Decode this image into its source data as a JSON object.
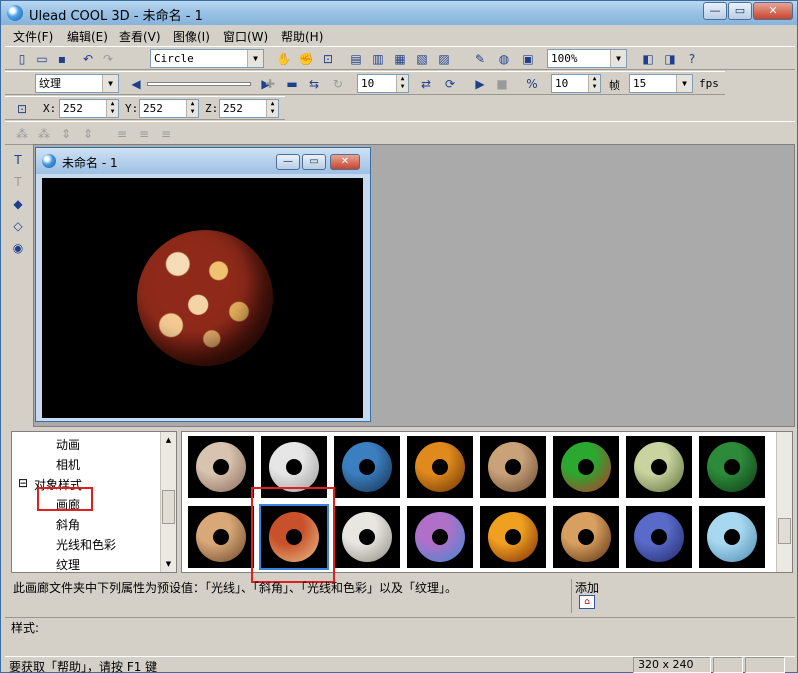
{
  "window": {
    "title": "Ulead COOL 3D - 未命名 - 1",
    "min": "—",
    "restore": "▭",
    "close": "✕"
  },
  "menu": [
    "文件(F)",
    "编辑(E)",
    "查看(V)",
    "图像(I)",
    "窗口(W)",
    "帮助(H)"
  ],
  "toolbar1": {
    "object_combo": "Circle",
    "zoom_combo": "100%"
  },
  "toolbar2": {
    "attribute_combo": "纹理",
    "frame_value_a": "10",
    "frame_value_b": "10",
    "frame_label": "帧",
    "fps_value": "15",
    "fps_label": "fps"
  },
  "toolbar3": {
    "x_label": "X:",
    "x_value": "252",
    "y_label": "Y:",
    "y_value": "252",
    "z_label": "Z:",
    "z_value": "252"
  },
  "doc": {
    "title": "未命名 - 1"
  },
  "tree": {
    "items": [
      {
        "label": "动画"
      },
      {
        "label": "相机"
      },
      {
        "label": "对象样式"
      },
      {
        "label": "画廊"
      },
      {
        "label": "斜角"
      },
      {
        "label": "光线和色彩"
      },
      {
        "label": "纹理"
      }
    ]
  },
  "gallery": {
    "thumbnails": [
      {
        "color_a": "#d8c2b0",
        "color_b": "#8a6a5a"
      },
      {
        "color_a": "#e6e6e6",
        "color_b": "#9a9a9a"
      },
      {
        "color_a": "#3c7fc0",
        "color_b": "#12304f"
      },
      {
        "color_a": "#e08a1e",
        "color_b": "#6b3205"
      },
      {
        "color_a": "#c9a27a",
        "color_b": "#6b4a2e"
      },
      {
        "color_a": "#2aa830",
        "color_b": "#c0342a"
      },
      {
        "color_a": "#c9d3a0",
        "color_b": "#5e6f3a"
      },
      {
        "color_a": "#2c8a3a",
        "color_b": "#0e3b16"
      },
      {
        "color_a": "#d9a879",
        "color_b": "#6a4427"
      },
      {
        "color_a": "#c8502a",
        "color_b": "#e8c08a"
      },
      {
        "color_a": "#e8e6e0",
        "color_b": "#8d8a82"
      },
      {
        "color_a": "#b070c8",
        "color_b": "#3c8ad0"
      },
      {
        "color_a": "#f0a020",
        "color_b": "#7a2a05"
      },
      {
        "color_a": "#d8a060",
        "color_b": "#5a2e10"
      },
      {
        "color_a": "#5a6ac8",
        "color_b": "#1e2a6a"
      },
      {
        "color_a": "#a8d8f0",
        "color_b": "#4a8ab0"
      }
    ]
  },
  "description": "此画廊文件夹中下列属性为预设值：「光线」、「斜角」、「光线和色彩」以及「纹理」。",
  "add_label": "添加",
  "style_label": "样式:",
  "status": {
    "message": "要获取「帮助」，请按 F1 键",
    "size": "320 x 240"
  },
  "colors": {
    "highlight": "#e02020",
    "selection": "#3b84e0"
  }
}
